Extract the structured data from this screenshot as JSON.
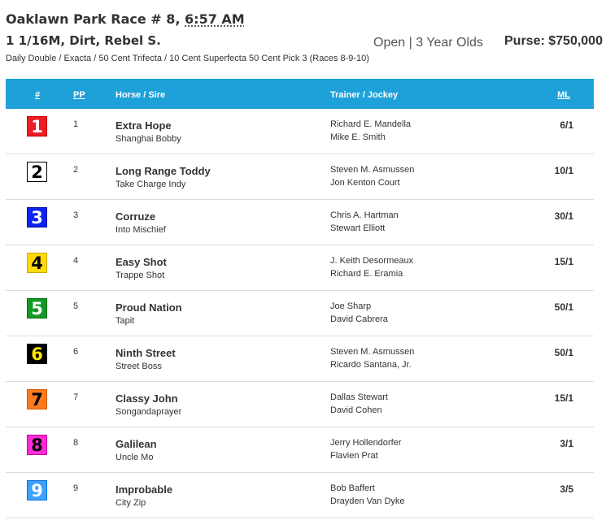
{
  "race": {
    "title_prefix": "Oaklawn Park Race # 8, ",
    "post_time": "6:57 AM",
    "details": "1 1/16M, Dirt, Rebel S.",
    "conditions": "Open | 3 Year Olds",
    "purse": "Purse: $750,000",
    "wagers": "Daily Double / Exacta / 50 Cent Trifecta / 10 Cent Superfecta 50 Cent Pick 3 (Races 8-9-10)"
  },
  "table": {
    "headers": {
      "num": "#",
      "pp": "PP",
      "horse_sire": "Horse / Sire",
      "trainer_jockey": "Trainer / Jockey",
      "ml": "ML"
    },
    "colors": {
      "header_bg": "#1da1d8"
    },
    "entries": [
      {
        "num": "1",
        "pp": "1",
        "horse": "Extra Hope",
        "sire": "Shanghai Bobby",
        "trainer": "Richard E. Mandella",
        "jockey": "Mike E. Smith",
        "ml": "6/1",
        "bg": "#ee1c25",
        "fg": "#ffffff",
        "border": "#c40000"
      },
      {
        "num": "2",
        "pp": "2",
        "horse": "Long Range Toddy",
        "sire": "Take Charge Indy",
        "trainer": "Steven M. Asmussen",
        "jockey": "Jon Kenton Court",
        "ml": "10/1",
        "bg": "#ffffff",
        "fg": "#000000",
        "border": "#000000"
      },
      {
        "num": "3",
        "pp": "3",
        "horse": "Corruze",
        "sire": "Into Mischief",
        "trainer": "Chris A. Hartman",
        "jockey": "Stewart Elliott",
        "ml": "30/1",
        "bg": "#0b24f0",
        "fg": "#ffffff",
        "border": "#0010a0"
      },
      {
        "num": "4",
        "pp": "4",
        "horse": "Easy Shot",
        "sire": "Trappe Shot",
        "trainer": "J. Keith Desormeaux",
        "jockey": "Richard E. Eramia",
        "ml": "15/1",
        "bg": "#ffd90a",
        "fg": "#000000",
        "border": "#c9a800"
      },
      {
        "num": "5",
        "pp": "5",
        "horse": "Proud Nation",
        "sire": "Tapit",
        "trainer": "Joe Sharp",
        "jockey": "David Cabrera",
        "ml": "50/1",
        "bg": "#119b23",
        "fg": "#ffffff",
        "border": "#0a6b18"
      },
      {
        "num": "6",
        "pp": "6",
        "horse": "Ninth Street",
        "sire": "Street Boss",
        "trainer": "Steven M. Asmussen",
        "jockey": "Ricardo Santana, Jr.",
        "ml": "50/1",
        "bg": "#000000",
        "fg": "#ffe600",
        "border": "#000000"
      },
      {
        "num": "7",
        "pp": "7",
        "horse": "Classy John",
        "sire": "Songandaprayer",
        "trainer": "Dallas Stewart",
        "jockey": "David Cohen",
        "ml": "15/1",
        "bg": "#ff7a1c",
        "fg": "#000000",
        "border": "#d05a00"
      },
      {
        "num": "8",
        "pp": "8",
        "horse": "Galilean",
        "sire": "Uncle Mo",
        "trainer": "Jerry Hollendorfer",
        "jockey": "Flavien Prat",
        "ml": "3/1",
        "bg": "#ff2bd6",
        "fg": "#000000",
        "border": "#c000a0"
      },
      {
        "num": "9",
        "pp": "9",
        "horse": "Improbable",
        "sire": "City Zip",
        "trainer": "Bob Baffert",
        "jockey": "Drayden Van Dyke",
        "ml": "3/5",
        "bg": "#3aa3ff",
        "fg": "#ffffff",
        "border": "#1070d0"
      }
    ]
  }
}
